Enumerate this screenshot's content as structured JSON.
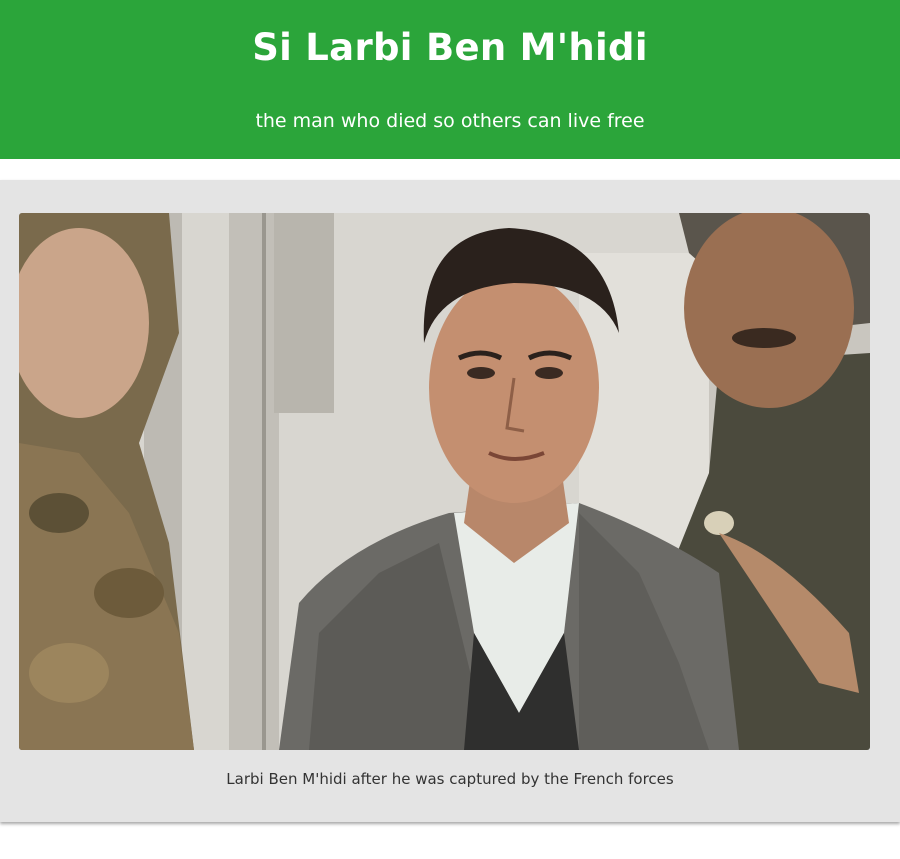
{
  "header": {
    "title": "Si Larbi Ben M'hidi",
    "subtitle": "the man who died so others can live free",
    "background_color": "#2ba53a"
  },
  "figure": {
    "caption": "Larbi Ben M'hidi after he was captured by the French forces"
  }
}
